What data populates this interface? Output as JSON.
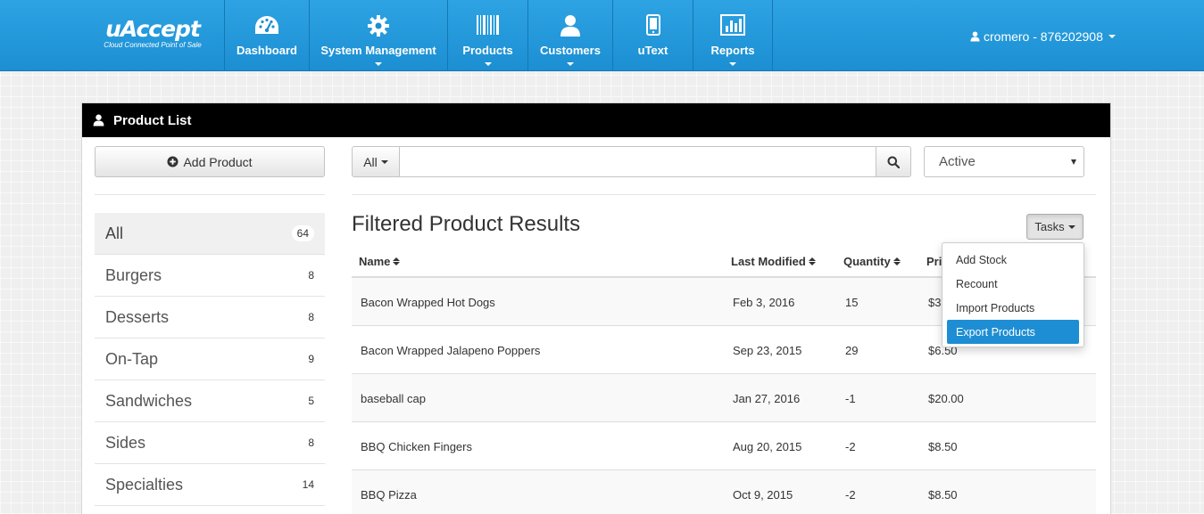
{
  "brand": {
    "name": "uAccept",
    "tagline": "Cloud Connected Point of Sale"
  },
  "nav": {
    "items": [
      {
        "label": "Dashboard",
        "icon": "dashboard-gauge-icon",
        "dropdown": false
      },
      {
        "label": "System Management",
        "icon": "gear-icon",
        "dropdown": true
      },
      {
        "label": "Products",
        "icon": "barcode-icon",
        "dropdown": true
      },
      {
        "label": "Customers",
        "icon": "user-icon",
        "dropdown": true
      },
      {
        "label": "uText",
        "icon": "mobile-phone-icon",
        "dropdown": false
      },
      {
        "label": "Reports",
        "icon": "bar-chart-icon",
        "dropdown": true
      }
    ],
    "user_label": "cromero - 876202908"
  },
  "panel": {
    "title": "Product List"
  },
  "sidebar": {
    "add_button": "Add Product",
    "categories": [
      {
        "label": "All",
        "count": "64",
        "active": true
      },
      {
        "label": "Burgers",
        "count": "8"
      },
      {
        "label": "Desserts",
        "count": "8"
      },
      {
        "label": "On-Tap",
        "count": "9"
      },
      {
        "label": "Sandwiches",
        "count": "5"
      },
      {
        "label": "Sides",
        "count": "8"
      },
      {
        "label": "Specialties",
        "count": "14"
      }
    ]
  },
  "search": {
    "scope_label": "All",
    "value": "",
    "status_value": "Active"
  },
  "results": {
    "title": "Filtered Product Results",
    "tasks_label": "Tasks",
    "columns": [
      "Name",
      "Last Modified",
      "Quantity",
      "Pri"
    ],
    "rows": [
      {
        "name": "Bacon Wrapped Hot Dogs",
        "modified": "Feb 3, 2016",
        "qty": "15",
        "price": "$3"
      },
      {
        "name": "Bacon Wrapped Jalapeno Poppers",
        "modified": "Sep 23, 2015",
        "qty": "29",
        "price": "$6.50"
      },
      {
        "name": "baseball cap",
        "modified": "Jan 27, 2016",
        "qty": "-1",
        "price": "$20.00"
      },
      {
        "name": "BBQ Chicken Fingers",
        "modified": "Aug 20, 2015",
        "qty": "-2",
        "price": "$8.50"
      },
      {
        "name": "BBQ Pizza",
        "modified": "Oct 9, 2015",
        "qty": "-2",
        "price": "$8.50"
      }
    ]
  },
  "tasks_menu": {
    "items": [
      "Add Stock",
      "Recount",
      "Import Products",
      "Export Products"
    ],
    "highlighted": "Export Products"
  },
  "colors": {
    "nav_blue": "#1b8fd2",
    "highlight_blue": "#1e8ed4",
    "panel_header": "#000000"
  }
}
